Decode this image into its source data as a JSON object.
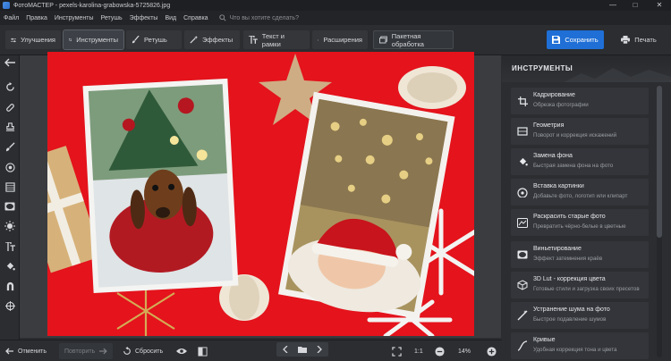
{
  "titlebar": {
    "title": "ФотоМАСТЕР - pexels-karolina-grabowska-5725826.jpg"
  },
  "menu": {
    "items": [
      "Файл",
      "Правка",
      "Инструменты",
      "Ретушь",
      "Эффекты",
      "Вид",
      "Справка"
    ],
    "search_placeholder": "Что вы хотите сделать?"
  },
  "toolbar": {
    "tabs": [
      "Улучшения",
      "Инструменты",
      "Ретушь",
      "Эффекты",
      "Текст и рамки",
      "Расширения"
    ],
    "active_tab": "Инструменты",
    "batch": "Пакетная обработка",
    "save": "Сохранить",
    "print": "Печать"
  },
  "panel": {
    "title": "ИНСТРУМЕНТЫ",
    "tools": [
      {
        "title": "Кадрирование",
        "subtitle": "Обрезка фотографии",
        "icon": "crop-icon"
      },
      {
        "title": "Геометрия",
        "subtitle": "Поворот и коррекция искажений",
        "icon": "geometry-icon"
      },
      {
        "title": "Замена фона",
        "subtitle": "Быстрая замена фона на фото",
        "icon": "bucket-icon"
      },
      {
        "title": "Вставка картинки",
        "subtitle": "Добавьте фото, логотип или клипарт",
        "icon": "insert-image-icon"
      },
      {
        "title": "Раскрасить старые фото",
        "subtitle": "Превратить чёрно-белые в цветные",
        "icon": "colorize-icon"
      },
      {
        "title": "Виньетирование",
        "subtitle": "Эффект затемнения краёв",
        "icon": "vignette-icon"
      },
      {
        "title": "3D Lut - коррекция цвета",
        "subtitle": "Готовые стили и загрузка своих пресетов",
        "icon": "lut-icon"
      },
      {
        "title": "Устранение шума на фото",
        "subtitle": "Быстрое подавление шумов",
        "icon": "noise-icon"
      },
      {
        "title": "Кривые",
        "subtitle": "Удобная коррекция тона и цвета",
        "icon": "curves-icon"
      }
    ]
  },
  "bottom": {
    "undo": "Отменить",
    "redo": "Повторить",
    "reset": "Сбросить",
    "ratio": "1:1",
    "zoom": "14%"
  }
}
